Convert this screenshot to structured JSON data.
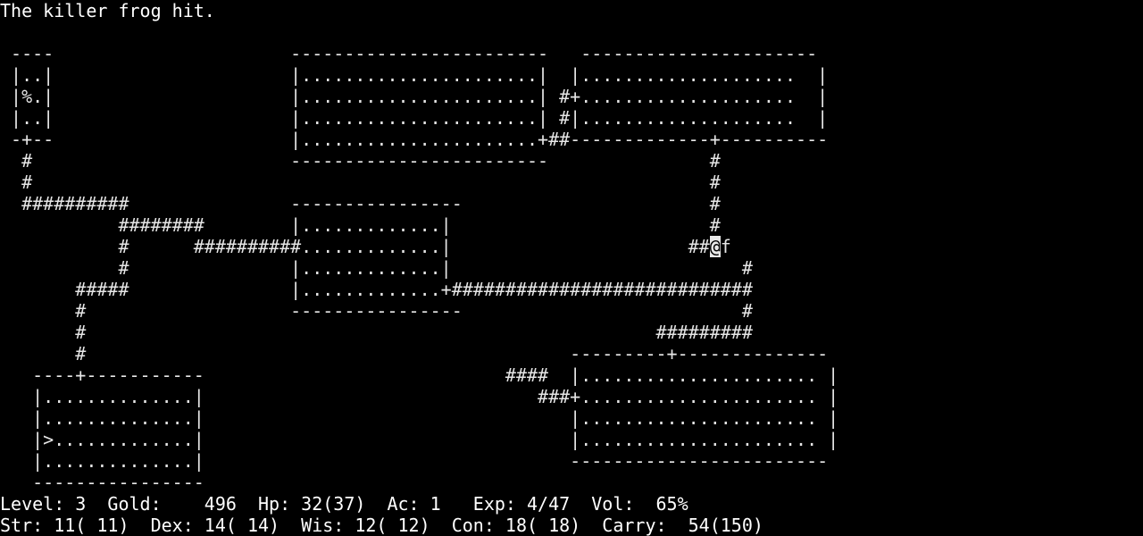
{
  "terminal": {
    "columns": 80,
    "rows": 25,
    "char_width": 16,
    "line_height": 24,
    "font_size": 20,
    "background_color": "#000000",
    "foreground_color": "#e8e8e8",
    "cursor_background_color": "#e8e8e8",
    "cursor_foreground_color": "#000000"
  },
  "message": {
    "text": "The killer frog hit."
  },
  "map": {
    "legend": {
      "player": "@",
      "monster_killer_frog": "f",
      "food_item": "%",
      "stairs_down": ">",
      "door": "+",
      "corridor": "#",
      "floor": ".",
      "wall_horizontal": "-",
      "wall_vertical": "|"
    },
    "rows": [
      "  ----",
      "  |..|                          ----------------------     ---------------------",
      "  |..|                          |....................|    |.....................|",
      "  |%.|                          |....................| #+.....................|",
      "  |..|                          |....................| #|.....................|",
      "  -+--                          |....................+##------------+----------",
      "   #                                                               #",
      "   #                                                               #",
      "   ##########                   ----------------                   #",
      "        ########                |..............|                   #",
      "        #       ##########+..............|                   ##@f",
      "        #                       |..............|                   #",
      "     #####                      |..............+############################",
      "     #                          ----------------                          #",
      "     #                                                          #########",
      "     #                                            ----------+--------------",
      "  ----+----------                          ####   |.....................|",
      "  |...............|                           ###+.....................|",
      "  |...............|                              |.....................|",
      "  |>..............|                              |.....................|",
      "  |...............|                              -----------------------",
      "  -----------------"
    ]
  },
  "status": {
    "line1": {
      "level_label": "Level:",
      "level_value": "3",
      "gold_label": "Gold:",
      "gold_value": "496",
      "hp_label": "Hp:",
      "hp_value": "32(37)",
      "ac_label": "Ac:",
      "ac_value": "1",
      "exp_label": "Exp:",
      "exp_value": "4/47",
      "vol_label": "Vol:",
      "vol_value": "65%",
      "full": "Level: 3  Gold:    496  Hp: 32(37)  Ac: 1   Exp: 4/47  Vol:  65%"
    },
    "line2": {
      "str_label": "Str:",
      "str_value": "11( 11)",
      "dex_label": "Dex:",
      "dex_value": "14( 14)",
      "wis_label": "Wis:",
      "wis_value": "12( 12)",
      "con_label": "Con:",
      "con_value": "18( 18)",
      "carry_label": "Carry:",
      "carry_value": "54(150)",
      "full": "Str: 11( 11)  Dex: 14( 14)  Wis: 12( 12)  Con: 18( 18)  Carry:  54(150)"
    }
  },
  "map_lines": {
    "r1": "    ----                      ---------------------- ---------------------",
    "r2": "    |..|                      |....................| |...................|",
    "r3": "    |%.|                      |....................|#+...................|",
    "r4": "    |..|                      |....................|#|...................|",
    "r5": "    -+--                      |....................+##-------------+-------",
    "r6": "     #                                                             #",
    "r7": "     #                                                             #",
    "r8": "     ##########               ----------------                     #",
    "r9": "          ########            |..............|                     #",
    "r10": "          #      #########+..............|                     ##@f",
    "r11": "          #                   |..............|                     #",
    "r12": "       #####                  |..............+#####################",
    "r13": "       #                      ----------------                    #",
    "r14": "       #                                                    #########",
    "r15": "       #                                        ---------+------------",
    "r16": "  ----+---------                         ####   |...................|",
    "r17": "  |.............|                         ###+...................|",
    "r18": "  |.............|                            |...................|",
    "r19": "  |>............|                            |...................|",
    "r20": "  |.............|                            ---------------------",
    "r21": "  ---------------"
  },
  "map_cells": [
    {
      "row": 1,
      "text": "----",
      "col": 1
    },
    {
      "row": 2,
      "text": "|..|",
      "col": 1
    },
    {
      "row": 3,
      "text": "|%.|",
      "col": 1
    },
    {
      "row": 4,
      "text": "|..|",
      "col": 1
    },
    {
      "row": 5,
      "text": "-+--",
      "col": 1
    },
    {
      "row": 6,
      "text": "#",
      "col": 2
    },
    {
      "row": 7,
      "text": "#",
      "col": 2
    },
    {
      "row": 8,
      "text": "##########",
      "col": 2
    },
    {
      "row": 9,
      "text": "########",
      "col": 11
    },
    {
      "row": 10,
      "text": "#",
      "col": 11
    },
    {
      "row": 11,
      "text": "#",
      "col": 11
    },
    {
      "row": 12,
      "text": "#####",
      "col": 7
    },
    {
      "row": 13,
      "text": "#",
      "col": 7
    },
    {
      "row": 14,
      "text": "#",
      "col": 7
    },
    {
      "row": 15,
      "text": "#",
      "col": 7
    },
    {
      "row": 1,
      "text": "----------------------",
      "col": 27
    },
    {
      "row": 2,
      "text": "|....................|",
      "col": 27
    },
    {
      "row": 3,
      "text": "|....................|",
      "col": 27
    },
    {
      "row": 4,
      "text": "|....................|",
      "col": 27
    },
    {
      "row": 5,
      "text": "|....................+##",
      "col": 27
    },
    {
      "row": 6,
      "text": "----------------------",
      "col": 27
    },
    {
      "row": 1,
      "text": "---------------------",
      "col": 54
    },
    {
      "row": 2,
      "text": "|...................|",
      "col": 54
    },
    {
      "row": 3,
      "text": "+...................|",
      "col": 54
    },
    {
      "row": 4,
      "text": "|...................|",
      "col": 54
    },
    {
      "row": 10,
      "text": "##@f",
      "col": 66
    },
    {
      "row": 19,
      "text": ">",
      "col": 4
    }
  ]
}
